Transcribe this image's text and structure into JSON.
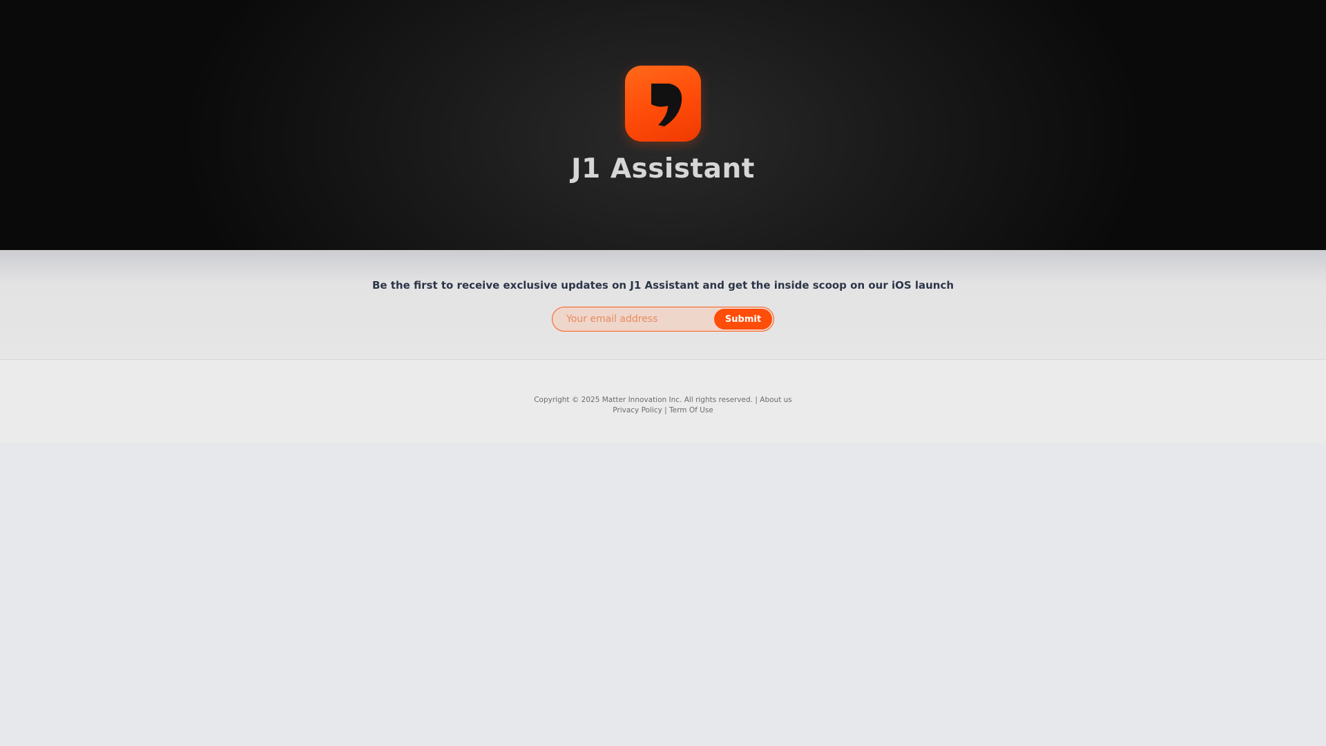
{
  "hero": {
    "app_name": "J1 Assistant",
    "logo_icon": "j1-logo-icon"
  },
  "signup": {
    "tagline": "Be the first to receive exclusive updates on J1 Assistant and get the inside scoop on our iOS launch",
    "email_placeholder": "Your email address",
    "email_value": "",
    "submit_label": "Submit"
  },
  "footer": {
    "copyright": "Copyright © 2025 Matter Innovation Inc. All rights reserved.",
    "sep1": "|",
    "about_label": "About us",
    "privacy_label": "Privacy Policy",
    "sep2": "|",
    "terms_label": "Term Of Use"
  },
  "colors": {
    "accent": "#ff4d0a",
    "hero_bg": "#1b1b1b",
    "title_text": "#d6d6d6",
    "tagline_text": "#2c3547"
  }
}
